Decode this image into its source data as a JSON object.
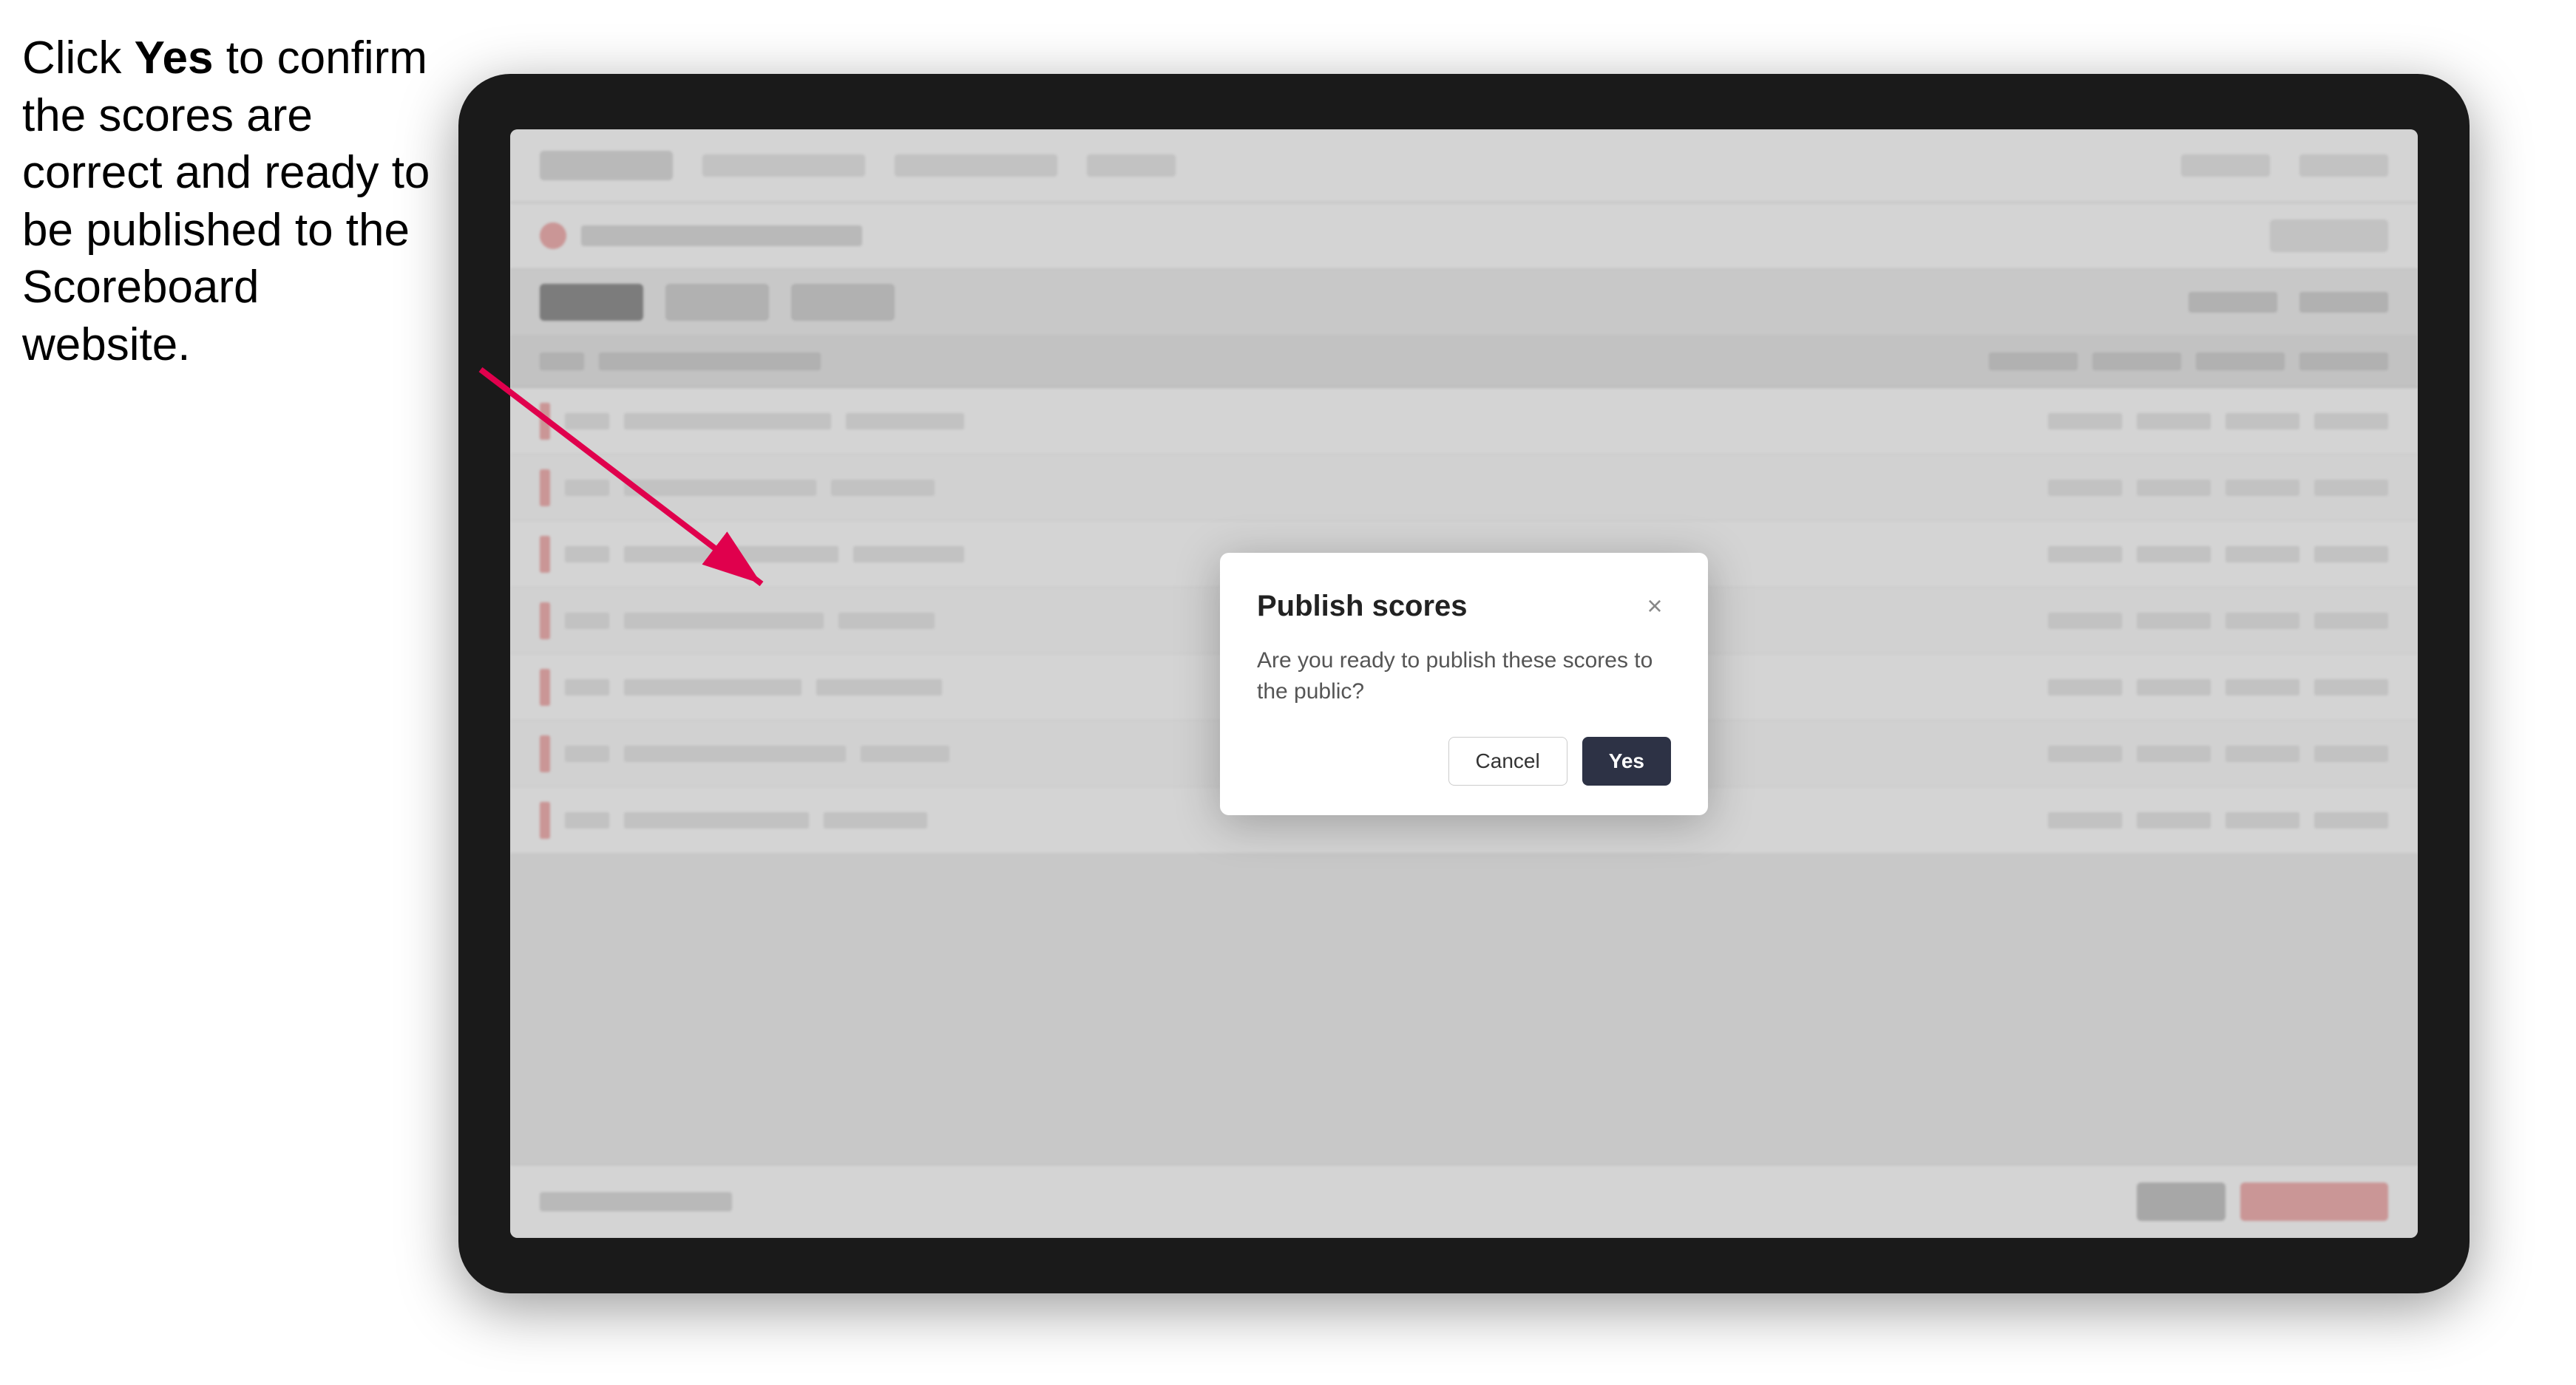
{
  "instruction": {
    "text_part1": "Click ",
    "text_bold": "Yes",
    "text_part2": " to confirm the scores are correct and ready to be published to the Scoreboard website."
  },
  "dialog": {
    "title": "Publish scores",
    "body": "Are you ready to publish these scores to the public?",
    "close_icon": "×",
    "cancel_label": "Cancel",
    "yes_label": "Yes"
  },
  "tablet": {
    "screen_background": "#f0f0f0"
  }
}
